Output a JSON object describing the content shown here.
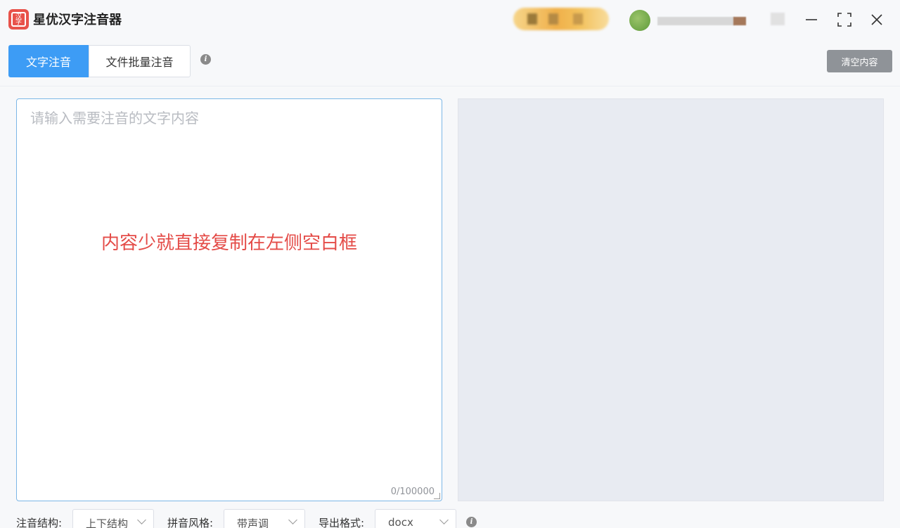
{
  "app": {
    "title": "星优汉字注音器",
    "icon_text": "汉字"
  },
  "window": {
    "minimize_icon": "minimize-icon",
    "maximize_icon": "maximize-icon",
    "close_icon": "close-icon"
  },
  "tabs": [
    {
      "label": "文字注音",
      "active": true
    },
    {
      "label": "文件批量注音",
      "active": false
    }
  ],
  "toolbar": {
    "clear_label": "清空内容"
  },
  "editor": {
    "placeholder": "请输入需要注音的文字内容",
    "note": "内容少就直接复制在左侧空白框",
    "counter": "0/100000"
  },
  "options": {
    "structure": {
      "label": "注音结构:",
      "value": "上下结构"
    },
    "pinyin_style": {
      "label": "拼音风格:",
      "value": "带声调"
    },
    "export_format": {
      "label": "导出格式:",
      "value": "docx"
    }
  },
  "colors": {
    "accent": "#3d9cf5",
    "note": "#e44b47",
    "app_icon": "#e8524a",
    "clear_button": "#8f9398"
  }
}
